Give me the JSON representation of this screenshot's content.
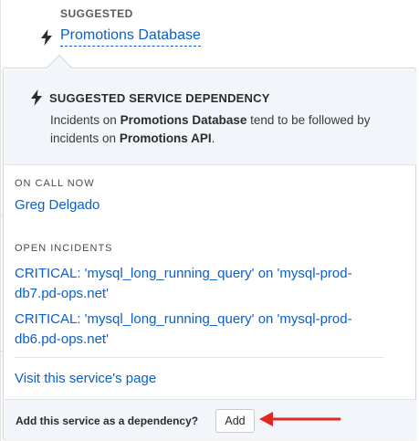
{
  "header": {
    "suggested_label": "SUGGESTED",
    "service_name": "Promotions Database"
  },
  "dependency": {
    "title": "SUGGESTED SERVICE DEPENDENCY",
    "desc_prefix": "Incidents on ",
    "service": "Promotions Database",
    "desc_middle": " tend to be followed by incidents on ",
    "dependent_service": "Promotions API",
    "desc_suffix": "."
  },
  "on_call": {
    "label": "ON CALL NOW",
    "name": "Greg Delgado"
  },
  "incidents": {
    "label": "OPEN INCIDENTS",
    "items": [
      "CRITICAL: 'mysql_long_running_query' on 'mysql-prod-db7.pd-ops.net'",
      "CRITICAL: 'mysql_long_running_query' on 'mysql-prod-db6.pd-ops.net'"
    ]
  },
  "service_page_link": "Visit this service's page",
  "footer": {
    "question": "Add this service as a dependency?",
    "add_label": "Add"
  },
  "colors": {
    "link": "#0b5fc6",
    "panel_bg": "#f2f6fb",
    "arrow": "#e0281e"
  },
  "icons": [
    "lightning-bolt-icon",
    "red-arrow-indicator"
  ]
}
